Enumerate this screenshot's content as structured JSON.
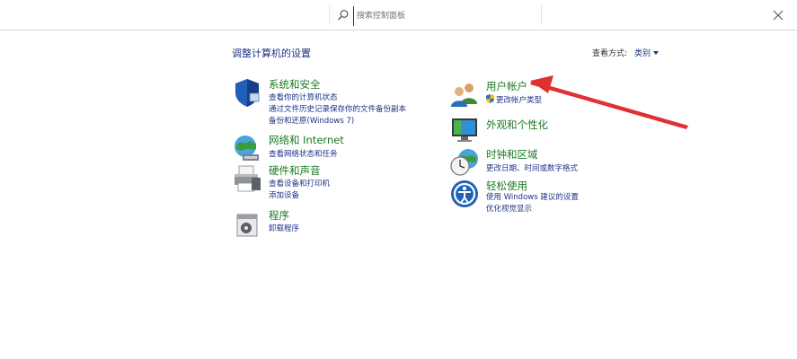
{
  "search": {
    "placeholder": "搜索控制面板"
  },
  "page": {
    "title": "调整计算机的设置",
    "view_label": "查看方式:",
    "view_mode": "类别"
  },
  "left": [
    {
      "title": "系统和安全",
      "icon": "security-shield-icon",
      "links": [
        "查看你的计算机状态",
        "通过文件历史记录保存你的文件备份副本",
        "备份和还原(Windows 7)"
      ]
    },
    {
      "title": "网络和 Internet",
      "icon": "network-globe-icon",
      "links": [
        "查看网络状态和任务"
      ]
    },
    {
      "title": "硬件和声音",
      "icon": "printer-icon",
      "links": [
        "查看设备和打印机",
        "添加设备"
      ]
    },
    {
      "title": "程序",
      "icon": "programs-icon",
      "links": [
        "卸载程序"
      ]
    }
  ],
  "right": [
    {
      "title": "用户帐户",
      "icon": "users-icon",
      "links": [
        "更改帐户类型"
      ]
    },
    {
      "title": "外观和个性化",
      "icon": "appearance-monitor-icon",
      "links": []
    },
    {
      "title": "时钟和区域",
      "icon": "clock-globe-icon",
      "links": [
        "更改日期、时间或数字格式"
      ]
    },
    {
      "title": "轻松使用",
      "icon": "ease-of-access-icon",
      "links": [
        "使用 Windows 建议的设置",
        "优化视觉显示"
      ]
    }
  ],
  "colors": {
    "category_title": "#1c7a22",
    "link": "#1e3287",
    "annotation_arrow": "#e03030"
  }
}
